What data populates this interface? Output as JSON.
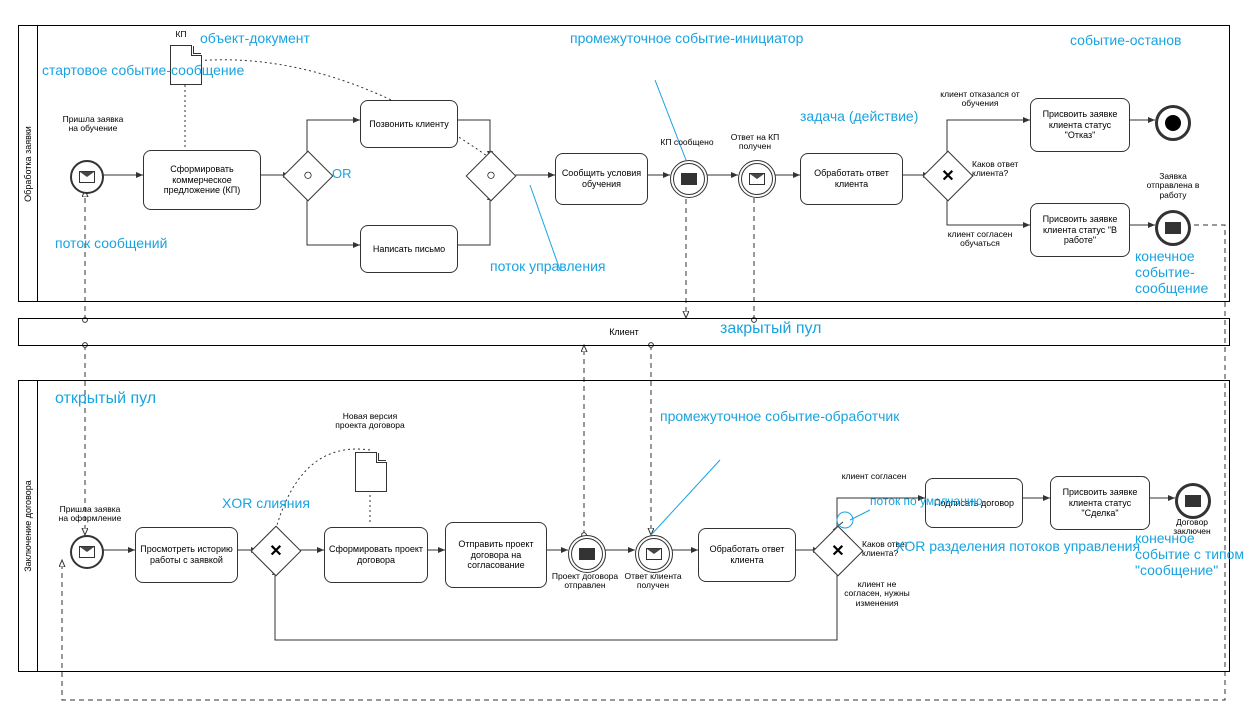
{
  "pool1": {
    "lane": "Обработка заявки",
    "startLabel": "Пришла заявка на обучение",
    "docLabel": "КП",
    "t1": "Сформировать коммерческое предложение (КП)",
    "t2": "Позвонить клиенту",
    "t3": "Написать письмо",
    "t4": "Сообщить условия обучения",
    "evt1": "КП сообщено",
    "evt2": "Ответ на КП получен",
    "t5": "Обработать ответ клиента",
    "gwQ": "Каков ответ клиента?",
    "cond1": "клиент отказался от обучения",
    "cond2": "клиент согласен обучаться",
    "t6": "Присвоить заявке клиента статус \"Отказ\"",
    "t7": "Присвоить заявке клиента статус \"В работе\"",
    "endLabel": "Заявка отправлена в работу",
    "or": "OR"
  },
  "clientPool": "Клиент",
  "pool2": {
    "lane": "Заключение договора",
    "startLabel": "Пришла заявка на оформление",
    "t1": "Просмотреть историю работы с заявкой",
    "docLabel": "Новая версия проекта договора",
    "t2": "Сформировать проект договора",
    "t3": "Отправить проект договора на согласование",
    "evt1": "Проект договора отправлен",
    "evt2": "Ответ клиента получен",
    "t4": "Обработать ответ клиента",
    "gwQ": "Каков ответ клиента?",
    "cond1": "клиент согласен",
    "cond2": "клиент не согласен, нужны изменения",
    "t5": "Подписать договор",
    "t6": "Присвоить заявке клиента статус \"Сделка\"",
    "endLabel": "Договор заключен",
    "xorMerge": "XOR слияния"
  },
  "anno": {
    "objDoc": "объект-документ",
    "startMsg": "стартовое событие-сообщение",
    "msgFlow": "поток сообщений",
    "ctrlFlow": "поток управления",
    "interInit": "промежуточное событие-инициатор",
    "taskAct": "задача (действие)",
    "endStop": "событие-останов",
    "endMsg": "конечное событие-сообщение",
    "closedPool": "закрытый пул",
    "openPool": "открытый пул",
    "interHandler": "промежуточное событие-обработчик",
    "defaultFlow": "поток по умолчанию",
    "xorSplit": "XOR разделения потоков управления",
    "endMsgType": "конечное событие с типом \"сообщение\""
  }
}
